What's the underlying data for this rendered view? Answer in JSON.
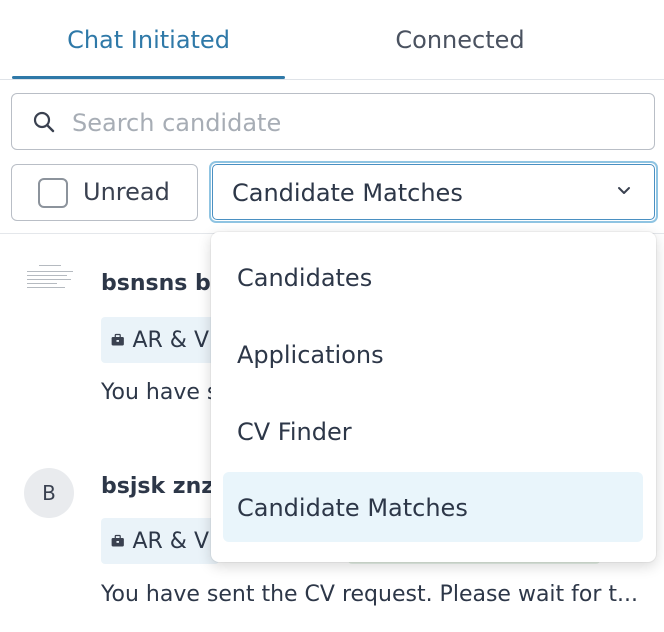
{
  "tabs": [
    {
      "label": "Chat Initiated",
      "active": true
    },
    {
      "label": "Connected",
      "active": false
    }
  ],
  "search": {
    "placeholder": "Search candidate",
    "value": ""
  },
  "filters": {
    "unread_label": "Unread",
    "unread_checked": false,
    "source_selected": "Candidate Matches"
  },
  "chats": [
    {
      "name": "bsnsns b",
      "job_tag": "AR & V",
      "message": "You have s"
    },
    {
      "name": "bsjsk znz",
      "avatar_initial": "B",
      "job_tag": "AR & V",
      "message": "You have sent the CV request. Please wait for t..."
    }
  ],
  "dropdown": {
    "options": [
      "Candidates",
      "Applications",
      "CV Finder",
      "Candidate Matches"
    ],
    "selected_index": 3
  },
  "colors": {
    "accent": "#2f79a8",
    "focus_border": "#8fc4e2",
    "tag_bg": "#eaf3f9",
    "selected_option_bg": "#e9f5fb"
  },
  "icons": {
    "search": "search-icon",
    "chevron": "chevron-down-icon",
    "briefcase": "briefcase-icon"
  }
}
